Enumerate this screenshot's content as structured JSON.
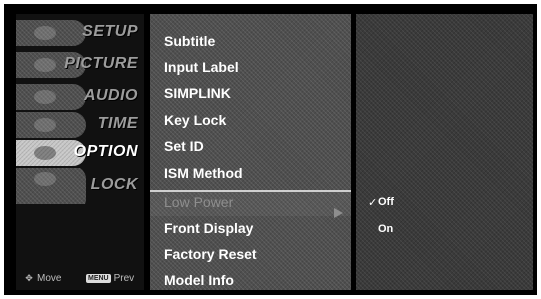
{
  "categories": [
    {
      "label": "SETUP",
      "icon": "setup-icon"
    },
    {
      "label": "PICTURE",
      "icon": "picture-icon"
    },
    {
      "label": "AUDIO",
      "icon": "audio-icon"
    },
    {
      "label": "TIME",
      "icon": "time-icon"
    },
    {
      "label": "OPTION",
      "icon": "option-icon",
      "active": true
    },
    {
      "label": "LOCK",
      "icon": "lock-icon"
    }
  ],
  "hints": {
    "move": "Move",
    "prev_key": "MENU",
    "prev": "Prev"
  },
  "menu": {
    "items": [
      "Subtitle",
      "Input Label",
      "SIMPLINK",
      "Key Lock",
      "Set ID",
      "ISM Method",
      "Low Power",
      "Front Display",
      "Factory Reset",
      "Model Info"
    ],
    "selected": "Low Power"
  },
  "submenu": {
    "options": [
      "Off",
      "On"
    ],
    "checked": "Off",
    "check_mark": "✓"
  }
}
